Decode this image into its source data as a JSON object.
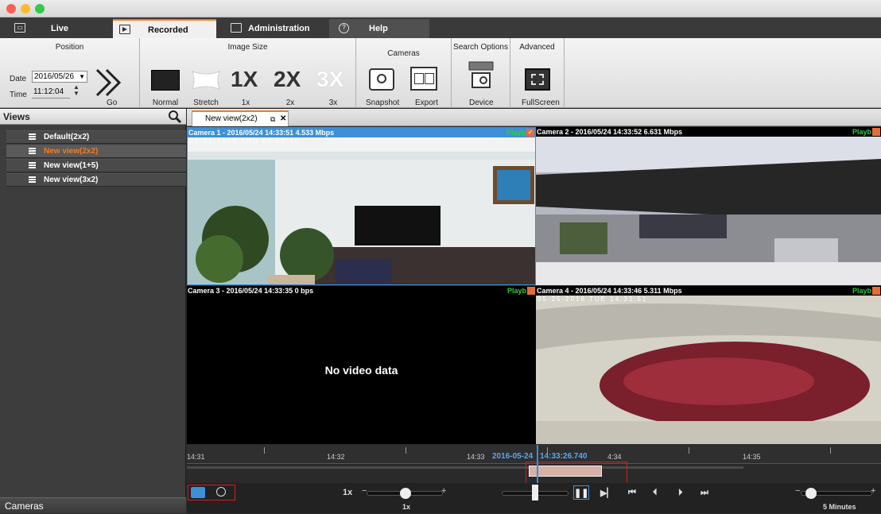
{
  "window": {
    "traffic_lights": [
      "#fc5f57",
      "#fdbc2e",
      "#34c84a"
    ]
  },
  "tabs": [
    {
      "label": "Live",
      "icon": "monitor-icon"
    },
    {
      "label": "Recorded",
      "icon": "play-icon"
    },
    {
      "label": "Administration",
      "icon": "folder-icon"
    },
    {
      "label": "Help",
      "icon": "help-icon"
    }
  ],
  "ribbon": {
    "position": {
      "title": "Position",
      "date_label": "Date",
      "date_value": "2016/05/26",
      "time_label": "Time",
      "time_value": "11:12:04",
      "go_label": "Go"
    },
    "image_size": {
      "title": "Image Size",
      "normal": "Normal",
      "stretch": "Stretch",
      "z1_big": "1X",
      "z1": "1x",
      "z2_big": "2X",
      "z2": "2x",
      "z3_big": "3X",
      "z3": "3x"
    },
    "cameras": {
      "title": "Cameras",
      "snapshot": "Snapshot",
      "export": "Export"
    },
    "search": {
      "title": "Search Options",
      "device": "Device"
    },
    "advanced": {
      "title": "Advanced",
      "fullscreen": "FullScreen"
    }
  },
  "views_panel": {
    "title": "Views",
    "items": [
      {
        "label": "Default(2x2)"
      },
      {
        "label": "New view(2x2)"
      },
      {
        "label": "New view(1+5)"
      },
      {
        "label": "New view(3x2)"
      }
    ],
    "cameras_title": "Cameras"
  },
  "view_tab": {
    "label": "New view(2x2)"
  },
  "cameras": [
    {
      "label": "Camera 1 - 2016/05/24 14:33:51  4.533 Mbps",
      "osd": "01-01-1970 THU 00:53:45",
      "status": "Playb"
    },
    {
      "label": "Camera 2 - 2016/05/24 14:33:52  6.631 Mbps",
      "status": "Playb"
    },
    {
      "label": "Camera 3 - 2016/05/24 14:33:35  0 bps",
      "status": "Playb",
      "message": "No video data"
    },
    {
      "label": "Camera 4 - 2016/05/24 14:33:46  5.311 Mbps",
      "osd": "05-25-2016 TUE 14:33:51",
      "status": "Playb"
    }
  ],
  "timeline": {
    "ticks": [
      "14:31",
      "14:32",
      "14:33",
      "4:34",
      "14:35"
    ],
    "current_date": "2016-05-24",
    "current_time": "14:33:26.740"
  },
  "controls": {
    "speed_label": "1x",
    "speed_value": "1x",
    "zoom_value": "5 Minutes"
  },
  "colors": {
    "accent": "#f07d20",
    "selection": "#3f8fd8",
    "playback": "#2ecc40"
  }
}
